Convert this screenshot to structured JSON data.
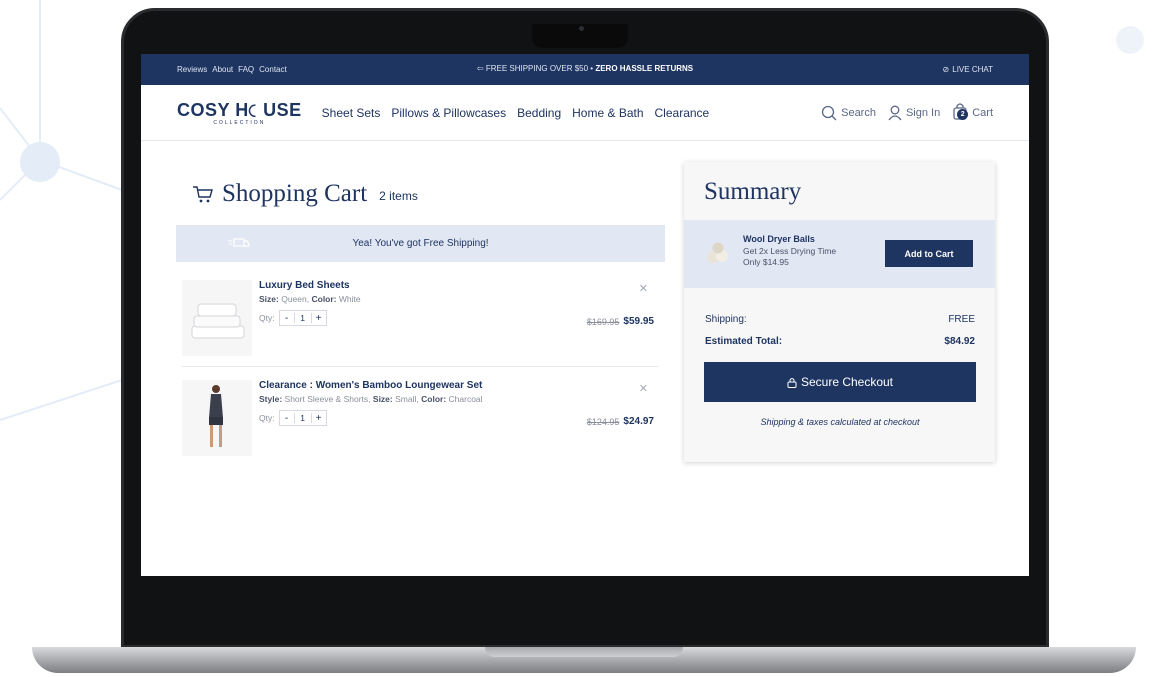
{
  "topbar": {
    "links": [
      "Reviews",
      "About",
      "FAQ",
      "Contact"
    ],
    "promo_text": "FREE SHIPPING OVER $50 •",
    "promo_bold": "ZERO HASSLE RETURNS",
    "live_chat": "LIVE CHAT"
  },
  "header": {
    "logo_name": "COSY H",
    "logo_name_rest": "USE",
    "logo_sub": "COLLECTION",
    "nav": [
      "Sheet Sets",
      "Pillows & Pillowcases",
      "Bedding",
      "Home & Bath",
      "Clearance"
    ],
    "search_label": "Search",
    "signin_label": "Sign In",
    "cart_label": "Cart",
    "cart_count": "2"
  },
  "cart": {
    "title": "Shopping Cart",
    "count_label": "2 items",
    "free_shipping_msg": "Yea! You've got Free Shipping!",
    "qty_label": "Qty:",
    "items": [
      {
        "name": "Luxury Bed Sheets",
        "attr1_label": "Size:",
        "attr1_value": "Queen,",
        "attr2_label": "Color:",
        "attr2_value": "White",
        "attr3_label": "",
        "attr3_value": "",
        "qty": "1",
        "old_price": "$169.95",
        "new_price": "$59.95"
      },
      {
        "name": "Clearance : Women's Bamboo Loungewear Set",
        "attr1_label": "Style:",
        "attr1_value": "Short Sleeve & Shorts,",
        "attr2_label": "Size:",
        "attr2_value": "Small,",
        "attr3_label": "Color:",
        "attr3_value": "Charcoal",
        "qty": "1",
        "old_price": "$124.95",
        "new_price": "$24.97"
      }
    ]
  },
  "summary": {
    "title": "Summary",
    "upsell_name": "Wool Dryer Balls",
    "upsell_desc1": "Get 2x Less Drying Time",
    "upsell_desc2": "Only $14.95",
    "upsell_button": "Add to Cart",
    "shipping_label": "Shipping:",
    "shipping_value": "FREE",
    "total_label": "Estimated Total:",
    "total_value": "$84.92",
    "checkout_label": "Secure Checkout",
    "note": "Shipping & taxes calculated at checkout"
  },
  "colors": {
    "brand_navy": "#1e3461",
    "light_blue_panel": "#e2e7f4"
  }
}
